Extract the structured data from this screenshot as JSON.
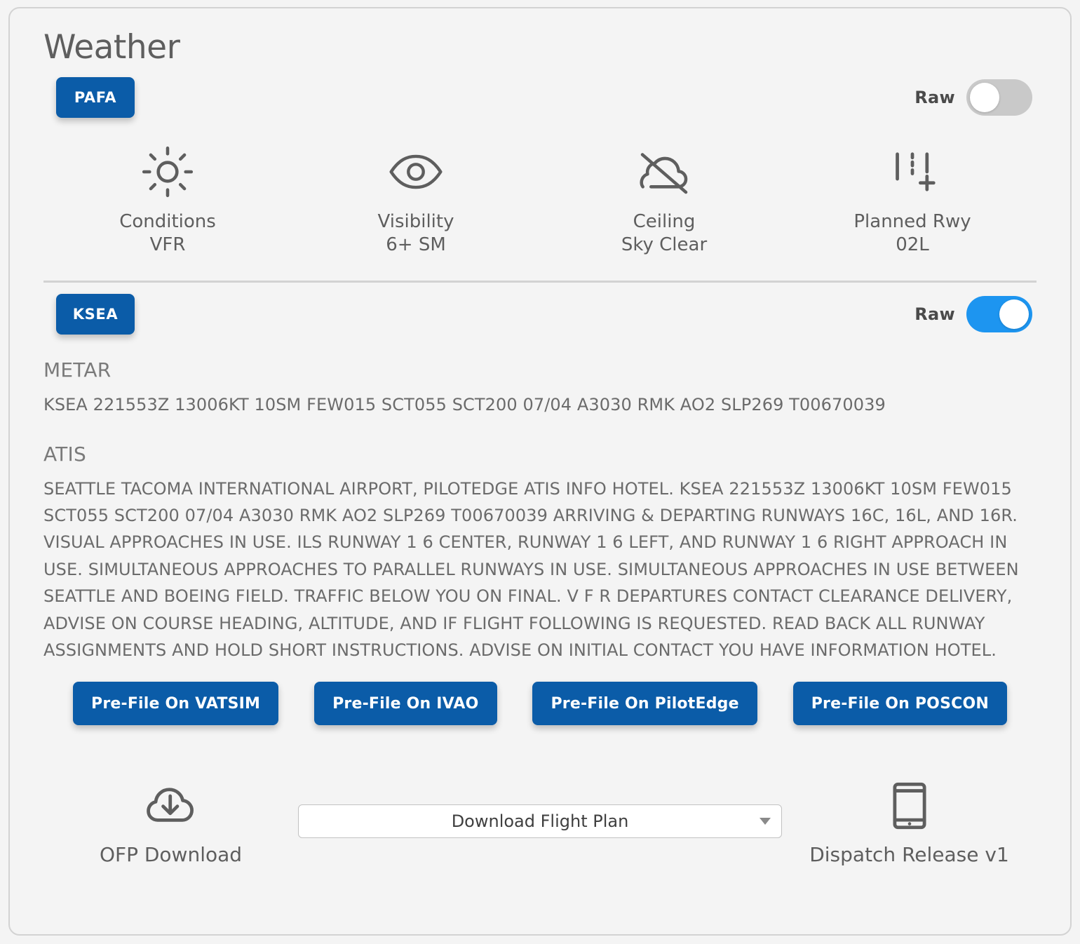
{
  "header": {
    "title": "Weather"
  },
  "stations": [
    {
      "code": "PAFA",
      "raw_label": "Raw",
      "raw_enabled": false,
      "metrics": [
        {
          "icon": "sun-icon",
          "label": "Conditions",
          "value": "VFR"
        },
        {
          "icon": "eye-icon",
          "label": "Visibility",
          "value": "6+ SM"
        },
        {
          "icon": "cloud-off-icon",
          "label": "Ceiling",
          "value": "Sky Clear"
        },
        {
          "icon": "runway-icon",
          "label": "Planned Rwy",
          "value": "02L"
        }
      ]
    },
    {
      "code": "KSEA",
      "raw_label": "Raw",
      "raw_enabled": true,
      "metar_heading": "METAR",
      "metar_text": "KSEA 221553Z 13006KT 10SM FEW015 SCT055 SCT200 07/04 A3030 RMK AO2 SLP269 T00670039",
      "atis_heading": "ATIS",
      "atis_text": "SEATTLE TACOMA INTERNATIONAL AIRPORT, PILOTEDGE ATIS INFO HOTEL. KSEA 221553Z 13006KT 10SM FEW015 SCT055 SCT200 07/04 A3030 RMK AO2 SLP269 T00670039 ARRIVING & DEPARTING RUNWAYS 16C, 16L, AND 16R. VISUAL APPROACHES IN USE. ILS RUNWAY 1 6 CENTER, RUNWAY 1 6 LEFT, AND RUNWAY 1 6 RIGHT APPROACH IN USE. SIMULTANEOUS APPROACHES TO PARALLEL RUNWAYS IN USE. SIMULTANEOUS APPROACHES IN USE BETWEEN SEATTLE AND BOEING FIELD. TRAFFIC BELOW YOU ON FINAL. V F R DEPARTURES CONTACT CLEARANCE DELIVERY, ADVISE ON COURSE HEADING, ALTITUDE, AND IF FLIGHT FOLLOWING IS REQUESTED. READ BACK ALL RUNWAY ASSIGNMENTS AND HOLD SHORT INSTRUCTIONS. ADVISE ON INITIAL CONTACT YOU HAVE INFORMATION HOTEL."
    }
  ],
  "prefile_buttons": [
    {
      "label": "Pre-File On VATSIM"
    },
    {
      "label": "Pre-File On IVAO"
    },
    {
      "label": "Pre-File On PilotEdge"
    },
    {
      "label": "Pre-File On POSCON"
    }
  ],
  "footer": {
    "ofp": {
      "icon": "cloud-download-icon",
      "label": "OFP Download"
    },
    "flight_plan_select": {
      "selected": "Download Flight Plan",
      "caret": "chevron-down-icon"
    },
    "dispatch": {
      "icon": "tablet-icon",
      "label": "Dispatch Release v1"
    }
  },
  "colors": {
    "brand_blue": "#0b5ca8",
    "toggle_on": "#1d95f0",
    "toggle_off": "#c9c9c9",
    "page_bg": "#f4f4f4",
    "text_gray": "#5e5e5e",
    "border_gray": "#d3d3d3"
  }
}
